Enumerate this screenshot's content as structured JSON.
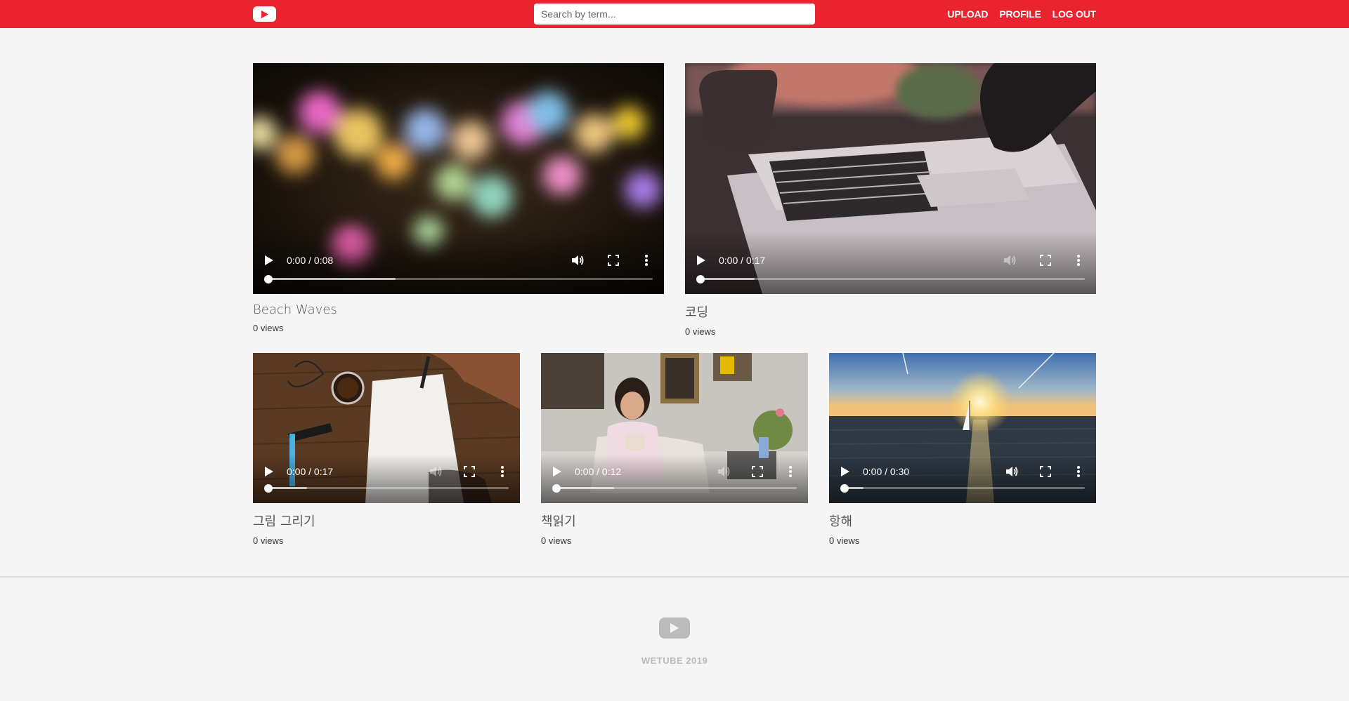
{
  "header": {
    "search_placeholder": "Search by term...",
    "nav": {
      "upload": "UPLOAD",
      "profile": "PROFILE",
      "logout": "LOG OUT"
    },
    "logo_icon": "play-logo-icon",
    "colors": {
      "brand": "#ea232f"
    }
  },
  "videos": [
    {
      "title": "Beach Waves",
      "views": "0 views",
      "time": "0:00 / 0:08",
      "progress": 0.0,
      "buffered": 0.33,
      "muted": false
    },
    {
      "title": "코딩",
      "views": "0 views",
      "time": "0:00 / 0:17",
      "progress": 0.0,
      "buffered": 0.14,
      "muted": true
    },
    {
      "title": "그림 그리기",
      "views": "0 views",
      "time": "0:00 / 0:17",
      "progress": 0.0,
      "buffered": 0.16,
      "muted": true
    },
    {
      "title": "책읽기",
      "views": "0 views",
      "time": "0:00 / 0:12",
      "progress": 0.0,
      "buffered": 0.24,
      "muted": true
    },
    {
      "title": "항해",
      "views": "0 views",
      "time": "0:00 / 0:30",
      "progress": 0.0,
      "buffered": 0.08,
      "muted": false
    }
  ],
  "footer": {
    "text": "WETUBE 2019"
  }
}
